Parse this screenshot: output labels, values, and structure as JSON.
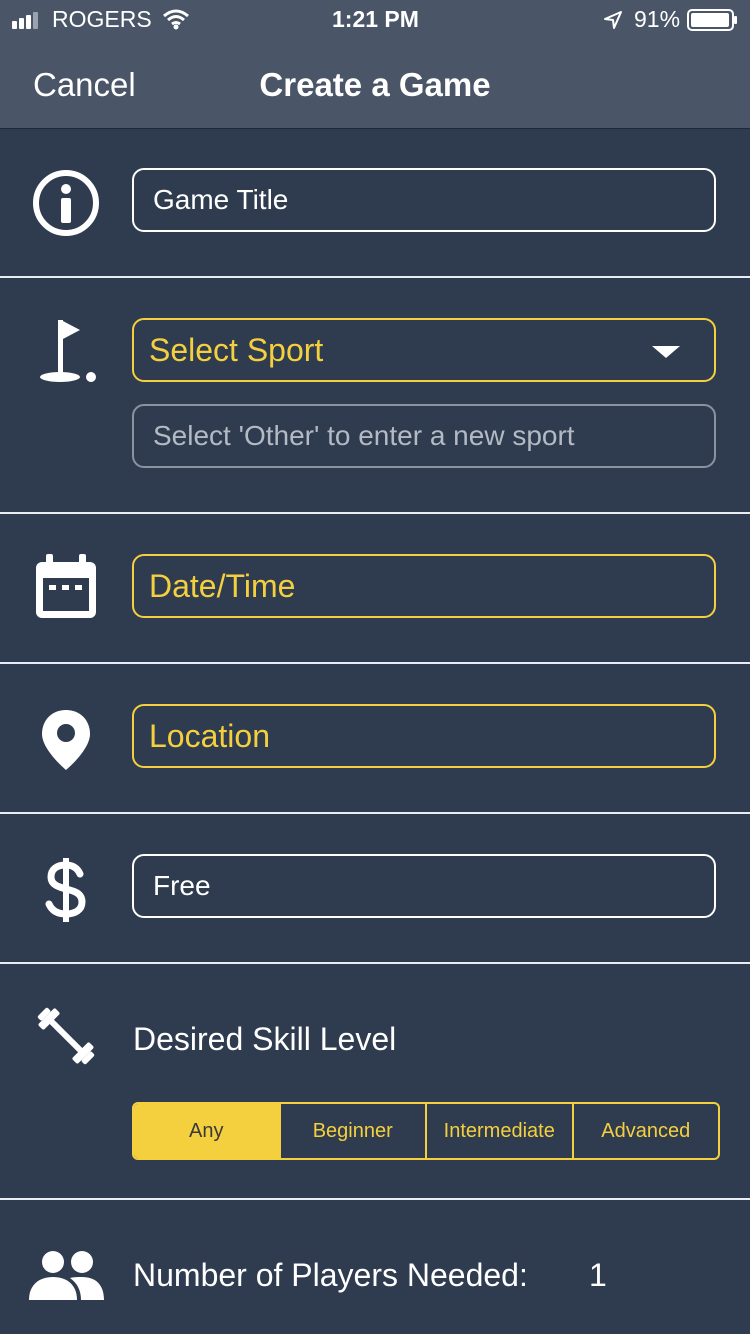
{
  "status_bar": {
    "carrier": "ROGERS",
    "time": "1:21 PM",
    "battery": "91%"
  },
  "nav": {
    "cancel": "Cancel",
    "title": "Create a Game"
  },
  "form": {
    "game_title_placeholder": "Game Title",
    "sport_select": "Select Sport",
    "sport_other_placeholder": "Select 'Other' to enter a new sport",
    "date_time": "Date/Time",
    "location": "Location",
    "price_value": "Free",
    "skill_label": "Desired Skill Level",
    "skill_options": [
      "Any",
      "Beginner",
      "Intermediate",
      "Advanced"
    ],
    "skill_selected": "Any",
    "players_label": "Number of Players Needed:",
    "players_value": "1"
  },
  "colors": {
    "accent": "#f4d03f",
    "background": "#2f3b4e",
    "header": "#4a5567"
  },
  "icons": [
    "signal-icon",
    "wifi-icon",
    "location-arrow-icon",
    "battery-icon",
    "info-icon",
    "golf-flag-icon",
    "calendar-icon",
    "map-pin-icon",
    "dollar-icon",
    "dumbbell-icon",
    "group-icon",
    "chevron-down-icon"
  ]
}
